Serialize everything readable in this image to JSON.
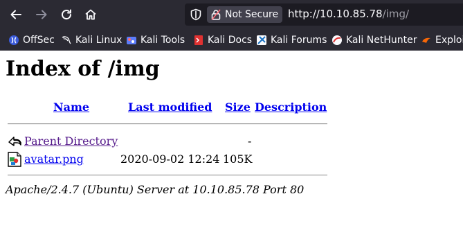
{
  "browser": {
    "security_label": "Not Secure",
    "url_host": "http://10.10.85.78",
    "url_path": "/img/",
    "bookmarks": [
      {
        "label": "OffSec",
        "icon": "offsec-icon"
      },
      {
        "label": "Kali Linux",
        "icon": "kali-dragon-icon"
      },
      {
        "label": "Kali Tools",
        "icon": "kali-tools-icon"
      },
      {
        "label": "Kali Docs",
        "icon": "kali-docs-icon"
      },
      {
        "label": "Kali Forums",
        "icon": "kali-forums-icon"
      },
      {
        "label": "Kali NetHunter",
        "icon": "nethunter-icon"
      },
      {
        "label": "Exploit",
        "icon": "exploit-db-icon"
      }
    ]
  },
  "page": {
    "title": "Index of /img",
    "columns": {
      "name": "Name",
      "last_modified": "Last modified",
      "size": "Size",
      "description": "Description"
    },
    "rows": [
      {
        "name": "Parent Directory",
        "last_modified": "",
        "size": "-",
        "icon": "back-arrow-icon"
      },
      {
        "name": "avatar.png",
        "last_modified": "2020-09-02 12:24",
        "size": "105K",
        "icon": "image-file-icon"
      }
    ],
    "footer": "Apache/2.4.7 (Ubuntu) Server at 10.10.85.78 Port 80"
  }
}
